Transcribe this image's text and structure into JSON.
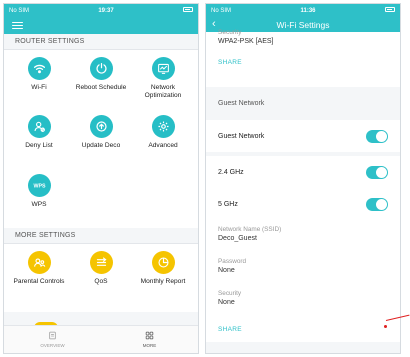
{
  "left": {
    "status": {
      "carrier": "No SIM",
      "time": "19:37"
    },
    "router_settings_header": "ROUTER SETTINGS",
    "router_items": [
      {
        "label": "Wi-Fi",
        "icon": "wifi-icon"
      },
      {
        "label": "Reboot Schedule",
        "icon": "reboot-schedule-icon"
      },
      {
        "label": "Network Optimization",
        "icon": "network-optimization-icon"
      },
      {
        "label": "Deny List",
        "icon": "deny-list-icon"
      },
      {
        "label": "Update Deco",
        "icon": "update-icon"
      },
      {
        "label": "Advanced",
        "icon": "gear-icon"
      },
      {
        "label": "WPS",
        "icon": "wps-icon"
      }
    ],
    "more_settings_header": "MORE SETTINGS",
    "more_items": [
      {
        "label": "Parental Controls",
        "icon": "parental-controls-icon"
      },
      {
        "label": "QoS",
        "icon": "qos-icon"
      },
      {
        "label": "Monthly Report",
        "icon": "monthly-report-icon"
      }
    ],
    "tabs": [
      {
        "label": "OVERVIEW",
        "icon": "overview-icon",
        "active": false
      },
      {
        "label": "MORE",
        "icon": "more-grid-icon",
        "active": true
      }
    ]
  },
  "right": {
    "status": {
      "carrier": "No SIM",
      "time": "11:36"
    },
    "title": "Wi-Fi Settings",
    "security_value": "WPA2-PSK [AES]",
    "share_label": "SHARE",
    "guest_section_label": "Guest Network",
    "guest_toggle_label": "Guest Network",
    "band_24_label": "2.4 GHz",
    "band_5_label": "5 GHz",
    "ssid_label": "Network Name (SSID)",
    "ssid_value": "Deco_Guest",
    "password_label": "Password",
    "password_value": "None",
    "security_label": "Security",
    "security_bottom_value": "None",
    "share_bottom_label": "SHARE"
  },
  "colors": {
    "accent": "#2ec0c8",
    "yellow": "#f5c400",
    "annotation": "#e02020"
  }
}
